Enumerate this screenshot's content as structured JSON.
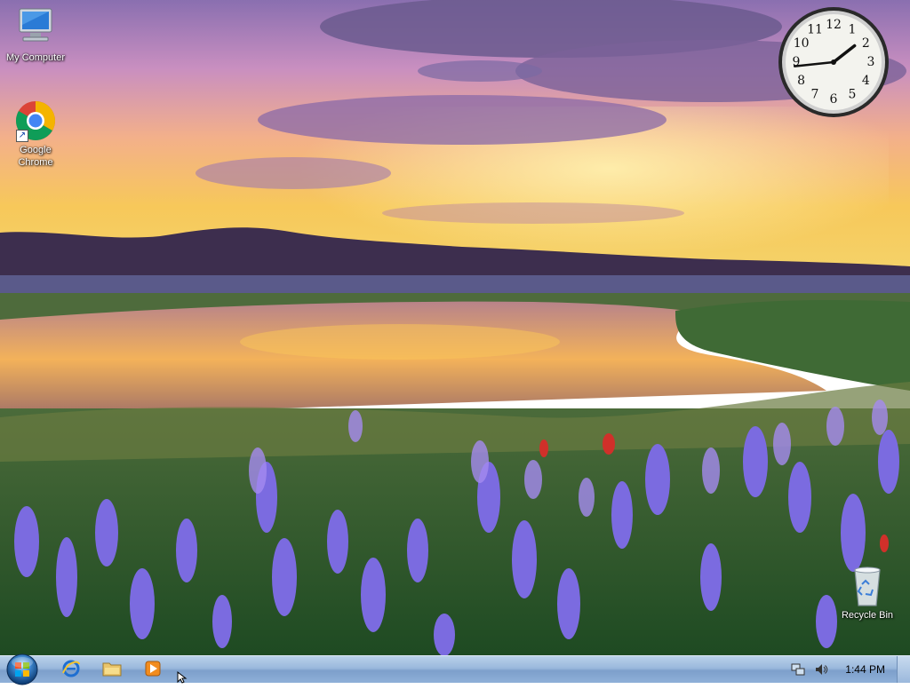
{
  "desktop": {
    "icons": [
      {
        "label": "My Computer"
      },
      {
        "label": "Google Chrome"
      },
      {
        "label": "Recycle Bin"
      }
    ],
    "clock_gadget": {
      "numerals": [
        "12",
        "1",
        "2",
        "3",
        "4",
        "5",
        "6",
        "7",
        "8",
        "9",
        "10",
        "11"
      ],
      "time": "1:44"
    }
  },
  "taskbar": {
    "pinned": [
      {
        "icon": "internet-explorer-icon"
      },
      {
        "icon": "windows-explorer-icon"
      },
      {
        "icon": "media-player-icon"
      }
    ],
    "tray": {
      "icons": [
        "network-icon",
        "volume-icon"
      ],
      "time": "1:44 PM"
    }
  },
  "colors": {
    "taskbar": "#9ab8dc",
    "sky_top": "#7a6aa8",
    "sunset": "#f7b34a",
    "flowers": "#7b6be0"
  }
}
